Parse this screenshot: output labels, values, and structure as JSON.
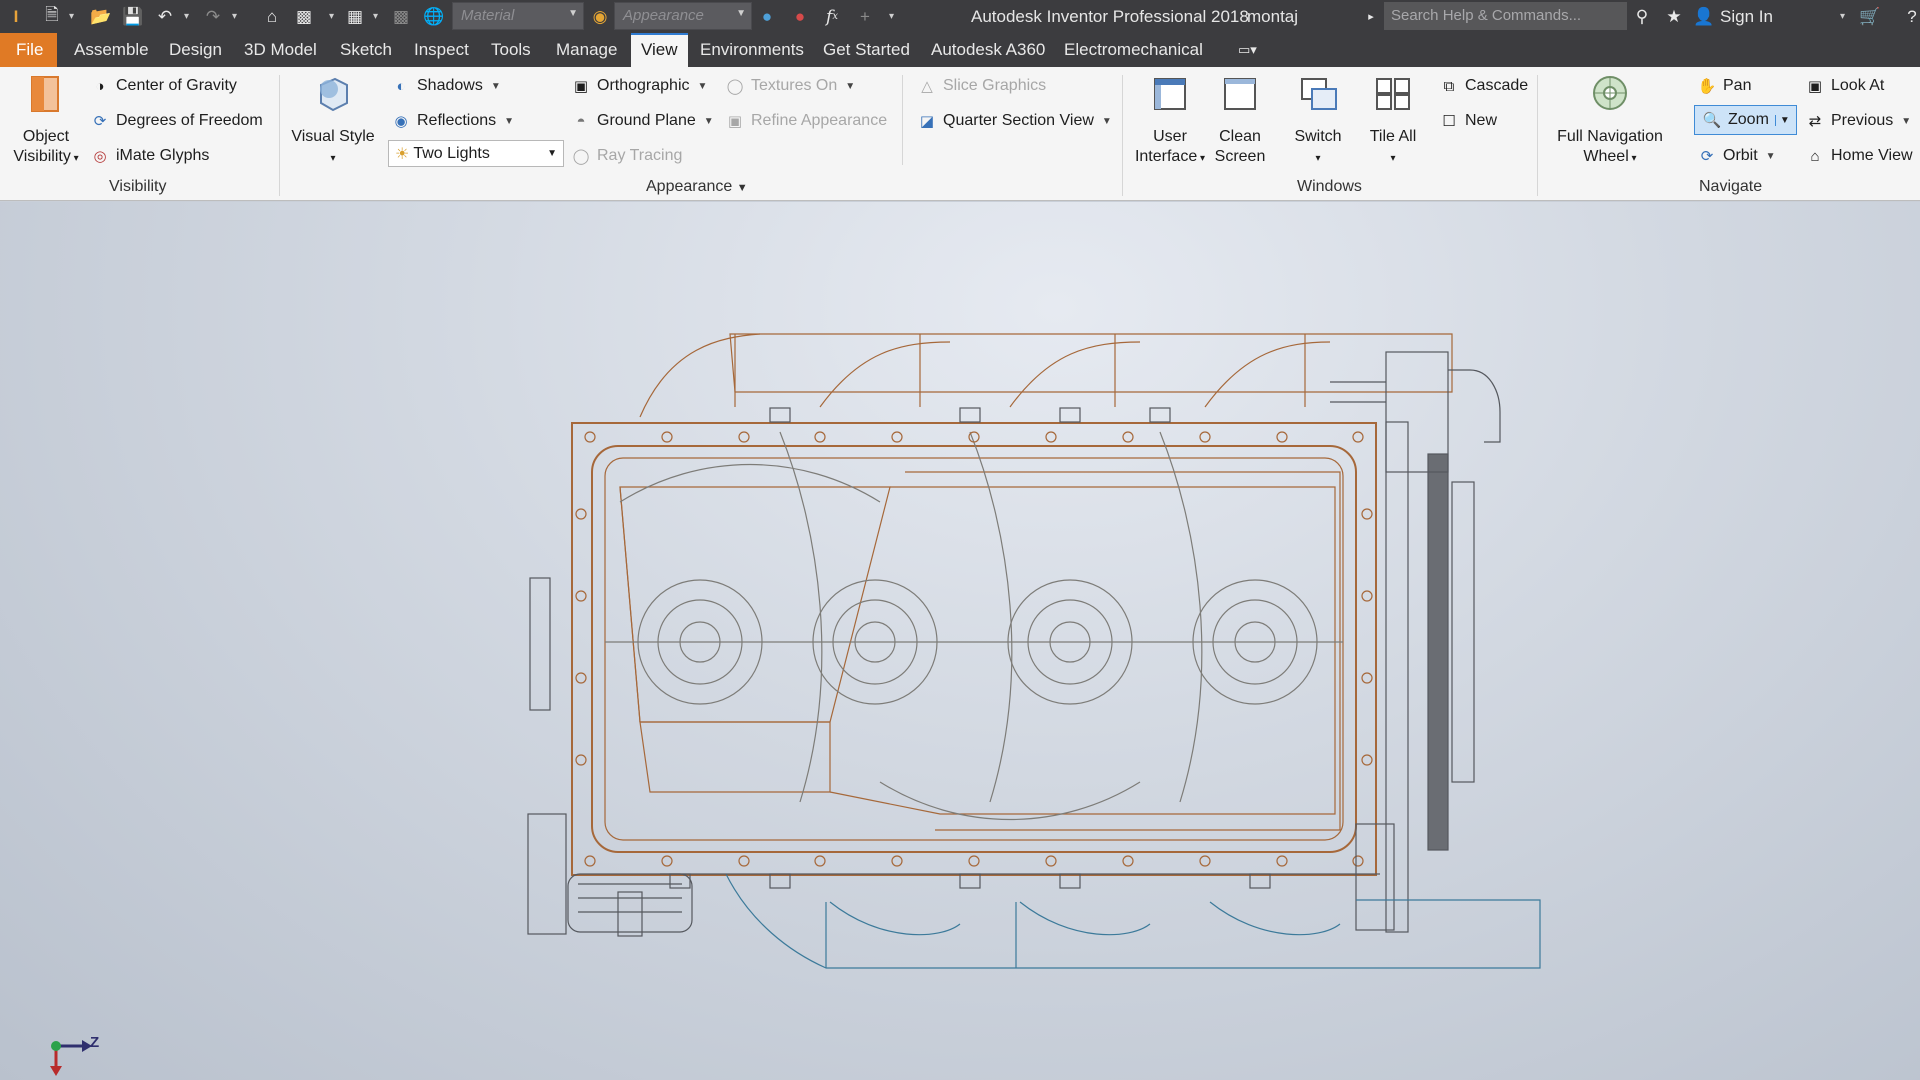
{
  "titlebar": {
    "app_title": "Autodesk Inventor Professional 2018",
    "document": "montaj",
    "material_placeholder": "Material",
    "appearance_placeholder": "Appearance",
    "search_placeholder": "Search Help & Commands...",
    "sign_in": "Sign In"
  },
  "tabs": {
    "file": "File",
    "items": [
      "Assemble",
      "Design",
      "3D Model",
      "Sketch",
      "Inspect",
      "Tools",
      "Manage",
      "View",
      "Environments",
      "Get Started",
      "Autodesk A360",
      "Electromechanical"
    ]
  },
  "visibility": {
    "object_visibility_line1": "Object",
    "object_visibility_line2": "Visibility",
    "center_of_gravity": "Center of Gravity",
    "degrees_of_freedom": "Degrees of Freedom",
    "imate_glyphs": "iMate Glyphs",
    "panel": "Visibility"
  },
  "appearance": {
    "visual_style": "Visual Style",
    "shadows": "Shadows",
    "reflections": "Reflections",
    "two_lights": "Two Lights",
    "orthographic": "Orthographic",
    "ground_plane": "Ground Plane",
    "ray_tracing": "Ray Tracing",
    "textures_on": "Textures On",
    "refine_appearance": "Refine Appearance",
    "slice_graphics": "Slice Graphics",
    "quarter_section_view": "Quarter Section View",
    "panel": "Appearance"
  },
  "windows": {
    "user_interface_line1": "User",
    "user_interface_line2": "Interface",
    "clean_screen_line1": "Clean",
    "clean_screen_line2": "Screen",
    "switch": "Switch",
    "tile_all": "Tile All",
    "cascade": "Cascade",
    "new": "New",
    "panel": "Windows"
  },
  "navigate": {
    "full_nav_line1": "Full Navigation",
    "full_nav_line2": "Wheel",
    "pan": "Pan",
    "zoom": "Zoom",
    "orbit": "Orbit",
    "look_at": "Look At",
    "previous": "Previous",
    "home_view": "Home View",
    "panel": "Navigate"
  },
  "axis": {
    "z_label": "Z"
  },
  "colors": {
    "file_tab": "#e07a25",
    "accent": "#2f7bd1",
    "wire_orange": "#a6683a",
    "wire_gray": "#7d7c78"
  }
}
